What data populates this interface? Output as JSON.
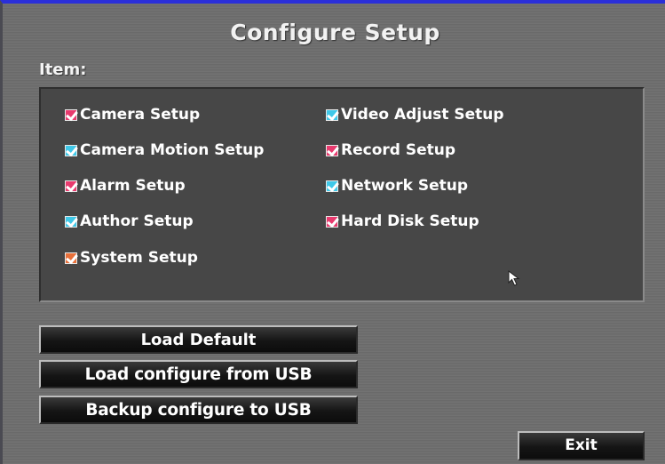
{
  "title": "Configure Setup",
  "item_label": "Item:",
  "items": [
    {
      "label": "Camera Setup",
      "checked": true,
      "check_color": "#e83a6e"
    },
    {
      "label": "Video Adjust Setup",
      "checked": true,
      "check_color": "#3fc8e8"
    },
    {
      "label": "Camera Motion Setup",
      "checked": true,
      "check_color": "#3fc8e8"
    },
    {
      "label": "Record Setup",
      "checked": true,
      "check_color": "#e83a6e"
    },
    {
      "label": "Alarm Setup",
      "checked": true,
      "check_color": "#e83a6e"
    },
    {
      "label": "Network Setup",
      "checked": true,
      "check_color": "#3fc8e8"
    },
    {
      "label": "Author Setup",
      "checked": true,
      "check_color": "#3fc8e8"
    },
    {
      "label": "Hard Disk Setup",
      "checked": true,
      "check_color": "#e83a6e"
    },
    {
      "label": "System Setup",
      "checked": true,
      "check_color": "#e8703a"
    }
  ],
  "buttons": {
    "load_default": "Load Default",
    "load_usb": "Load configure from USB",
    "backup_usb": "Backup configure to USB",
    "exit": "Exit"
  },
  "colors": {
    "title_bar_accent": "#2a2fd8",
    "panel_background": "#474747",
    "screen_background": "#6d6d6d"
  },
  "icons": {
    "checkbox": "checkbox-checked-icon",
    "cursor": "mouse-pointer-icon"
  }
}
